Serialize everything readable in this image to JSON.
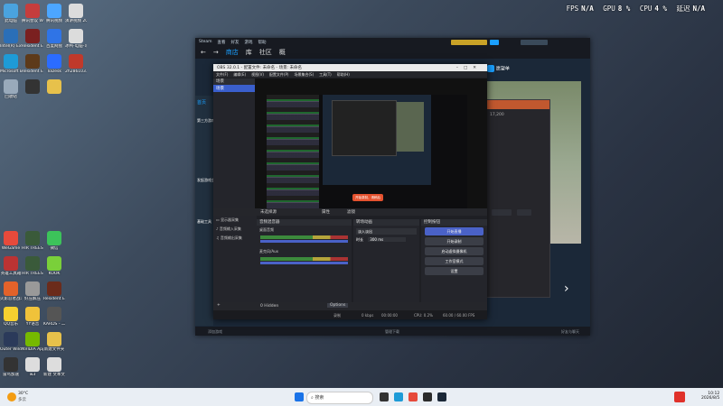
{
  "hud": {
    "fps_label": "FPS",
    "fps_val": "N/A",
    "gpu_label": "GPU",
    "gpu_val": "8 %",
    "cpu_label": "CPU",
    "cpu_val": "4 %",
    "delay_label": "延迟",
    "delay_val": "N/A"
  },
  "desktop_icons": [
    {
      "label": "此电脑",
      "color": "#4aa3df"
    },
    {
      "label": "腾讯会议 WeGame版",
      "color": "#c53d3d"
    },
    {
      "label": "腾讯视频",
      "color": "#4ca6ff"
    },
    {
      "label": "演讲视频 2026-07-2...",
      "color": "#dcdcdc"
    },
    {
      "label": "Intel(R) Extrem...",
      "color": "#2a6fb8"
    },
    {
      "label": "Resident Evil 2",
      "color": "#7a2020"
    },
    {
      "label": "百度网盘",
      "color": "#2f74e6"
    },
    {
      "label": "冰鸭-电脑-可参考到网...",
      "color": "#dcdcdc"
    },
    {
      "label": "Microsoft Edge",
      "color": "#1e9bd7"
    },
    {
      "label": "Resident Evil 4",
      "color": "#5d3a1a"
    },
    {
      "label": "ToDesk",
      "color": "#2b6cff"
    },
    {
      "label": "2h286103...",
      "color": "#c0392b"
    },
    {
      "label": "回收站",
      "color": "#9ab"
    },
    {
      "label": "",
      "color": "#333"
    },
    {
      "label": "",
      "color": "#e7c14b"
    },
    {
      "label": "WeGame",
      "color": "#e64a3b"
    },
    {
      "label": "HIR TREES PUZZLE",
      "color": "#3a5a3a"
    },
    {
      "label": "微信",
      "color": "#3cc35a"
    },
    {
      "label": "英雄工具箱",
      "color": "#b33"
    },
    {
      "label": "HIR TREES THE PUZZ...",
      "color": "#3a5a3a"
    },
    {
      "label": "KOOK",
      "color": "#7ad03a"
    },
    {
      "label": "火影忍者战斗",
      "color": "#e3622a"
    },
    {
      "label": "好压解压",
      "color": "#999"
    },
    {
      "label": "Resident Evil Re...",
      "color": "#6b2b1b"
    },
    {
      "label": "QQ音乐",
      "color": "#f6d02f"
    },
    {
      "label": "YY语音",
      "color": "#f0c23a"
    },
    {
      "label": "KARDS - 二战卡牌游戏",
      "color": "#555"
    },
    {
      "label": "Outer Wilds",
      "color": "#2b3a5a"
    },
    {
      "label": "NVIDIA App",
      "color": "#76b900"
    },
    {
      "label": "新建文件夹",
      "color": "#e7c14b"
    },
    {
      "label": "雷鸟加速",
      "color": "#333"
    },
    {
      "label": "w3",
      "color": "#ddd"
    },
    {
      "label": "新建 文本文档",
      "color": "#ddd"
    }
  ],
  "steam": {
    "titlebar": [
      "Steam",
      "查看",
      "好友",
      "游戏",
      "帮助"
    ],
    "nav": [
      "商店",
      "库",
      "社区",
      "概"
    ],
    "sidebar_items": [
      "首页",
      "第三方游戏",
      "发起游戏会话",
      "基础工具"
    ],
    "right_btn": "愿望单",
    "stats": "17,200",
    "status_left": "添加游戏",
    "status_mid": "管理下载",
    "status_right": "好友与聊天"
  },
  "obs": {
    "title": "OBS 32.0.1 - 配置文件: 未命名 - 场景: 未命名",
    "menu": [
      "文件(F)",
      "编辑(E)",
      "视图(V)",
      "配置文件(P)",
      "场景集合(S)",
      "工具(T)",
      "帮助(H)"
    ],
    "scenes_hdr": "场景",
    "scene_item": "场景",
    "sources": [
      "显示器采集",
      "音频输入采集",
      "音频输出采集"
    ],
    "no_source": "未选择源",
    "props": "属性",
    "filters": "滤镜",
    "mixer_hdr": "音频混音器",
    "trans_hdr": "转场动画",
    "ctrl_hdr": "控制按钮",
    "track1": "桌面音频",
    "track1_db": "0.0 dB",
    "track2": "麦克风/Aux",
    "track2_db": "0.0 dB",
    "fade": "淡入淡出",
    "duration_label": "时长",
    "duration_val": "300 ms",
    "btn_stream": "开始直播",
    "btn_record": "开始录制",
    "btn_vcam": "启动虚拟摄像机",
    "btn_studio": "工作室模式",
    "btn_settings": "设置",
    "btn_exit": "退出",
    "dock_label": "0 Hidden",
    "options": "Options",
    "preview_banner": "开始录制，请稍后",
    "status_rec": "录制",
    "status_time": "00:00:00",
    "status_kbps": "0 kbps",
    "status_cpu": "CPU: 0.2%",
    "status_fps": "60.00 / 60.00 FPS"
  },
  "taskbar": {
    "weather_temp": "30°C",
    "weather_desc": "多云",
    "search": "搜索",
    "time": "10:12",
    "date": "2026/8/5"
  }
}
